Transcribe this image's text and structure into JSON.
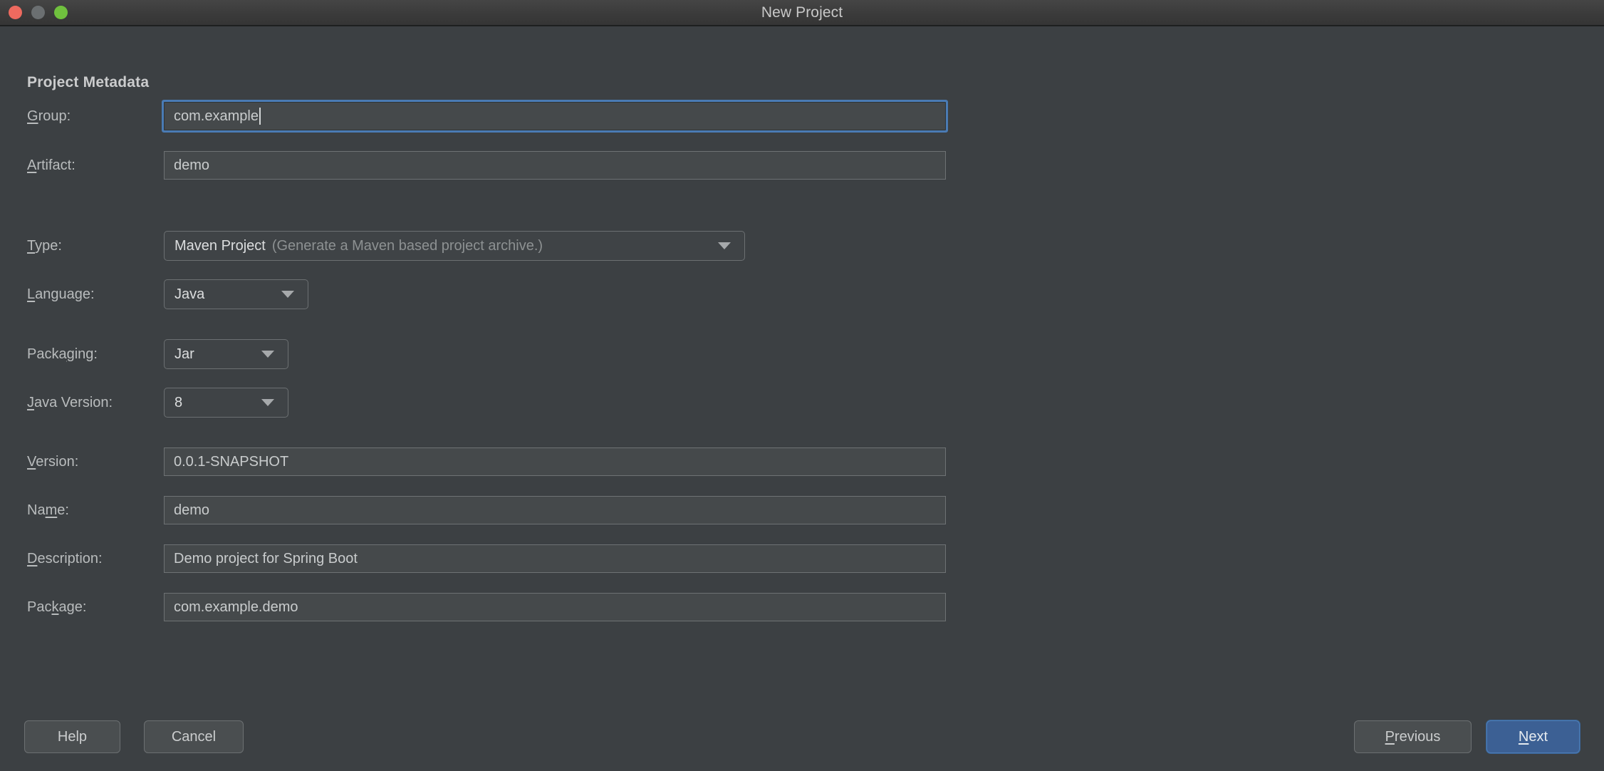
{
  "window": {
    "title": "New Project",
    "traffic_lights": [
      "close-button",
      "minimize-button",
      "maximize-button"
    ],
    "colors": {
      "close": "#ee6a5f",
      "minimize": "#6b6f71",
      "maximize": "#70c13e",
      "dialog_background": "#3c4043",
      "input_background": "#45494b",
      "focus_ring": "#4a7bb4",
      "primary_button": "#3c6094"
    }
  },
  "section": {
    "title": "Project Metadata"
  },
  "fields": {
    "group": {
      "label_pre": "",
      "label_mnemonic": "G",
      "label_post": "roup:",
      "value": "com.example",
      "focused": true
    },
    "artifact": {
      "label_pre": "",
      "label_mnemonic": "A",
      "label_post": "rtifact:",
      "value": "demo"
    },
    "type": {
      "label_pre": "",
      "label_mnemonic": "T",
      "label_post": "ype:",
      "value": "Maven Project",
      "hint": "(Generate a Maven based project archive.)"
    },
    "language": {
      "label_pre": "",
      "label_mnemonic": "L",
      "label_post": "anguage:",
      "value": "Java"
    },
    "packaging": {
      "label_pre": "Packa",
      "label_mnemonic": "g",
      "label_post": "ing:",
      "value": "Jar"
    },
    "java_version": {
      "label_pre": "",
      "label_mnemonic": "J",
      "label_post": "ava Version:",
      "value": "8"
    },
    "version": {
      "label_pre": "",
      "label_mnemonic": "V",
      "label_post": "ersion:",
      "value": "0.0.1-SNAPSHOT"
    },
    "name": {
      "label_pre": "Na",
      "label_mnemonic": "m",
      "label_post": "e:",
      "value": "demo"
    },
    "description": {
      "label_pre": "",
      "label_mnemonic": "D",
      "label_post": "escription:",
      "value": "Demo project for Spring Boot"
    },
    "package": {
      "label_pre": "Pac",
      "label_mnemonic": "k",
      "label_post": "age:",
      "value": "com.example.demo"
    }
  },
  "buttons": {
    "help": {
      "label": "Help"
    },
    "cancel": {
      "label": "Cancel"
    },
    "previous": {
      "label_pre": "",
      "label_mnemonic": "P",
      "label_post": "revious"
    },
    "next": {
      "label_pre": "",
      "label_mnemonic": "N",
      "label_post": "ext",
      "default": true
    }
  }
}
